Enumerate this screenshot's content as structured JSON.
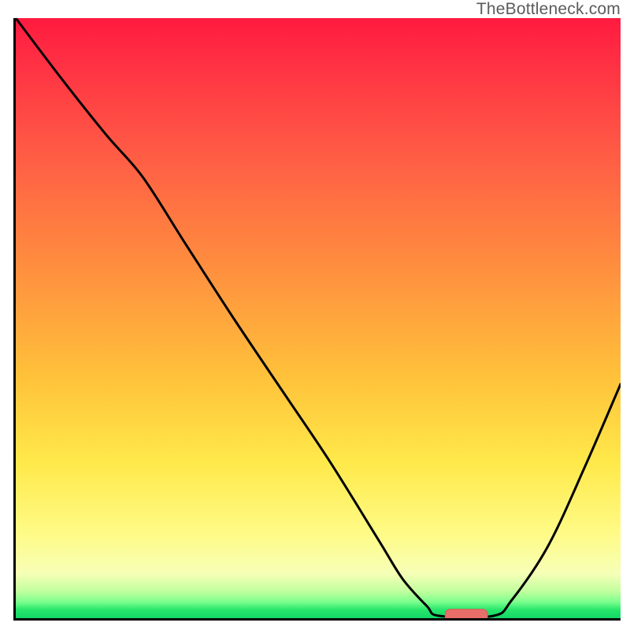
{
  "watermark": "TheBottleneck.com",
  "colors": {
    "axis": "#000000",
    "curve": "#000000",
    "marker_fill": "#e86e6a",
    "marker_stroke": "#d85c58",
    "gradient_stops": [
      "#ff1a3f",
      "#ff2f44",
      "#ff5a45",
      "#ff8a3f",
      "#ffc23a",
      "#ffe94a",
      "#fffb87",
      "#f6ffb6",
      "#c2ff9e",
      "#7bff8d",
      "#27e66b",
      "#13d867"
    ]
  },
  "chart_data": {
    "type": "line",
    "title": "",
    "xlabel": "",
    "ylabel": "",
    "xlim": [
      0,
      1
    ],
    "ylim": [
      0,
      1
    ],
    "series": [
      {
        "name": "curve",
        "x": [
          0.0,
          0.075,
          0.15,
          0.21,
          0.28,
          0.36,
          0.44,
          0.52,
          0.6,
          0.64,
          0.68,
          0.72,
          0.77,
          0.82,
          0.88,
          0.94,
          1.0
        ],
        "y": [
          1.0,
          0.9,
          0.805,
          0.735,
          0.625,
          0.5,
          0.38,
          0.26,
          0.13,
          0.065,
          0.02,
          0.004,
          0.004,
          0.03,
          0.12,
          0.25,
          0.39
        ]
      }
    ],
    "marker": {
      "x": 0.745,
      "y": 0.005,
      "rx": 0.035,
      "ry": 0.01
    },
    "flat_segment": {
      "x0": 0.7,
      "x1": 0.79,
      "y": 0.004
    }
  }
}
